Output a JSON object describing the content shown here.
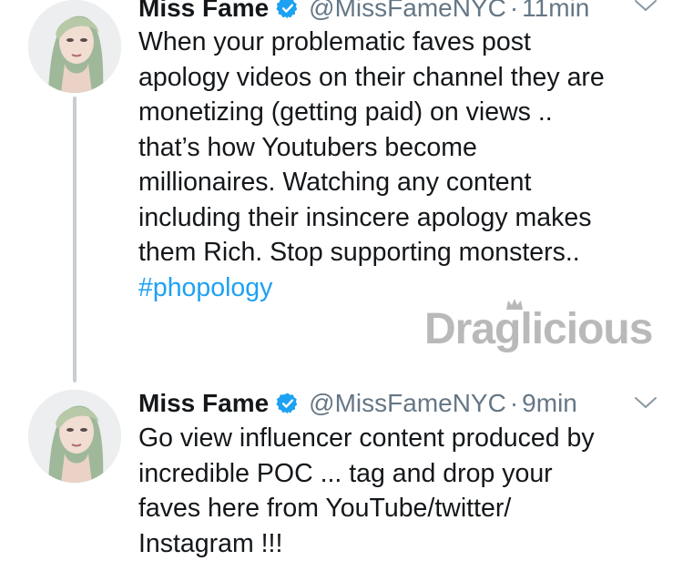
{
  "tweets": [
    {
      "name": "Miss Fame",
      "handle": "@MissFameNYC",
      "separator": "·",
      "time": "11min",
      "text_lines": [
        "When your problematic faves post",
        "apology videos on their channel they  are",
        "monetizing (getting paid) on views ..",
        "that’s how Youtubers become",
        "millionaires. Watching any content",
        "including their insincere apology makes",
        "them Rich. Stop supporting monsters.."
      ],
      "hashtag": "#phopology"
    },
    {
      "name": "Miss Fame",
      "handle": "@MissFameNYC",
      "separator": "·",
      "time": "9min",
      "text_lines": [
        "Go view influencer content produced by",
        "incredible POC ... tag and drop your",
        "faves here from YouTube/twitter/",
        "Instagram !!!"
      ]
    }
  ],
  "watermark": {
    "text": "Draglicious"
  },
  "icons": {
    "verified": "verified-badge-icon",
    "chevron": "chevron-down-icon"
  },
  "colors": {
    "text": "#14171a",
    "secondary": "#657786",
    "hashtag": "#1da1f2",
    "verified": "#1da1f2",
    "thread_line": "#c7cdd3"
  }
}
